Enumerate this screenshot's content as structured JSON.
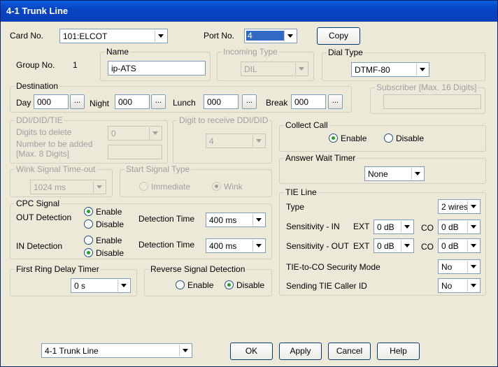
{
  "window": {
    "title": "4-1 Trunk Line"
  },
  "card": {
    "label": "Card No.",
    "value": "101:ELCOT"
  },
  "port": {
    "label": "Port No.",
    "value": "4"
  },
  "copy_label": "Copy",
  "group": {
    "label": "Group No.",
    "value": "1"
  },
  "name": {
    "legend": "Name",
    "value": "ip-ATS"
  },
  "incoming": {
    "legend": "Incoming Type",
    "value": "DIL"
  },
  "dialtype": {
    "legend": "Dial Type",
    "value": "DTMF-80"
  },
  "destination": {
    "legend": "Destination",
    "day_label": "Day",
    "day_value": "000",
    "night_label": "Night",
    "night_value": "000",
    "lunch_label": "Lunch",
    "lunch_value": "000",
    "break_label": "Break",
    "break_value": "000",
    "ellipsis": "..."
  },
  "subscriber": {
    "legend": "Subscriber [Max. 16 Digits]"
  },
  "ddi": {
    "legend": "DDI/DID/TIE",
    "delete_label": "Digits to delete",
    "delete_value": "0",
    "add_label1": "Number to be added",
    "add_label2": "[Max. 8 Digits]"
  },
  "digit_receive": {
    "legend": "Digit to receive DDI/DID",
    "value": "4"
  },
  "collect": {
    "legend": "Collect Call",
    "enable": "Enable",
    "disable": "Disable"
  },
  "answer": {
    "legend": "Answer Wait Timer",
    "value": "None"
  },
  "wink": {
    "legend": "Wink Signal Time-out",
    "value": "1024 ms"
  },
  "start_signal": {
    "legend": "Start Signal Type",
    "immediate": "Immediate",
    "wink": "Wink"
  },
  "cpc": {
    "legend": "CPC Signal",
    "out_label": "OUT Detection",
    "in_label": "IN Detection",
    "enable": "Enable",
    "disable": "Disable",
    "detect_label": "Detection Time",
    "out_time": "400 ms",
    "in_time": "400 ms"
  },
  "tie": {
    "legend": "TIE Line",
    "type_label": "Type",
    "type_value": "2 wires",
    "sens_in_label": "Sensitivity - IN",
    "sens_out_label": "Sensitivity - OUT",
    "ext": "EXT",
    "co": "CO",
    "in_ext": "0 dB",
    "in_co": "0 dB",
    "out_ext": "0 dB",
    "out_co": "0 dB",
    "security_label": "TIE-to-CO Security Mode",
    "security_value": "No",
    "callerid_label": "Sending TIE Caller ID",
    "callerid_value": "No"
  },
  "first_ring": {
    "legend": "First Ring Delay Timer",
    "value": "0 s"
  },
  "reverse": {
    "legend": "Reverse Signal Detection",
    "enable": "Enable",
    "disable": "Disable"
  },
  "bottom": {
    "nav_value": "4-1 Trunk Line",
    "ok": "OK",
    "apply": "Apply",
    "cancel": "Cancel",
    "help": "Help"
  }
}
